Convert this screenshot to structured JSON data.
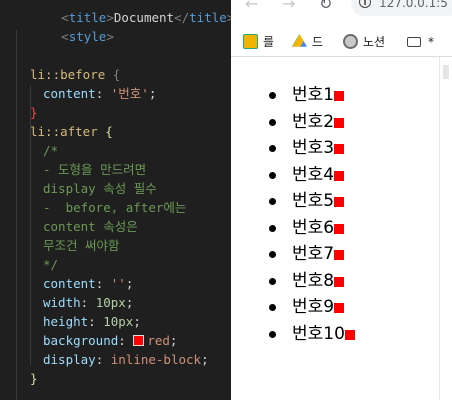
{
  "editor": {
    "lines": [
      {
        "text": "<title>Document</title>"
      },
      {
        "text": "<style>"
      },
      {
        "sel": "li::before",
        "brace": "{"
      },
      {
        "prop": "content",
        "val": "'번호'"
      },
      {
        "brace": "}"
      },
      {
        "sel": "li::after",
        "brace": "{"
      },
      {
        "com": "/*"
      },
      {
        "com": "- 도형을 만드려면"
      },
      {
        "com": "display 속성 필수"
      },
      {
        "com": "-  before, after에는"
      },
      {
        "com": "content 속성은"
      },
      {
        "com": "무조건 써야함"
      },
      {
        "com": "*/"
      },
      {
        "prop": "content",
        "val": "''"
      },
      {
        "prop": "width",
        "val": "10px"
      },
      {
        "prop": "height",
        "val": "10px"
      },
      {
        "prop": "background",
        "val": "red"
      },
      {
        "prop": "display",
        "val": "inline-block"
      },
      {
        "brace": "}"
      }
    ],
    "swatch_color": "#ff0000"
  },
  "browser": {
    "back_icon": "arrow-left-icon",
    "forward_icon": "arrow-right-icon",
    "reload_icon": "reload-icon",
    "address": "127.0.0.1:5",
    "bookmarks": [
      {
        "label": "를",
        "icon": "photo-icon"
      },
      {
        "label": "드",
        "icon": "drive-icon"
      },
      {
        "label": "노션",
        "icon": "avatar-icon"
      },
      {
        "label": "*",
        "icon": "folder-icon"
      }
    ]
  },
  "list": {
    "prefix": "번호",
    "items": [
      "1",
      "2",
      "3",
      "4",
      "5",
      "6",
      "7",
      "8",
      "9",
      "10"
    ],
    "box_color": "#ff0000"
  }
}
